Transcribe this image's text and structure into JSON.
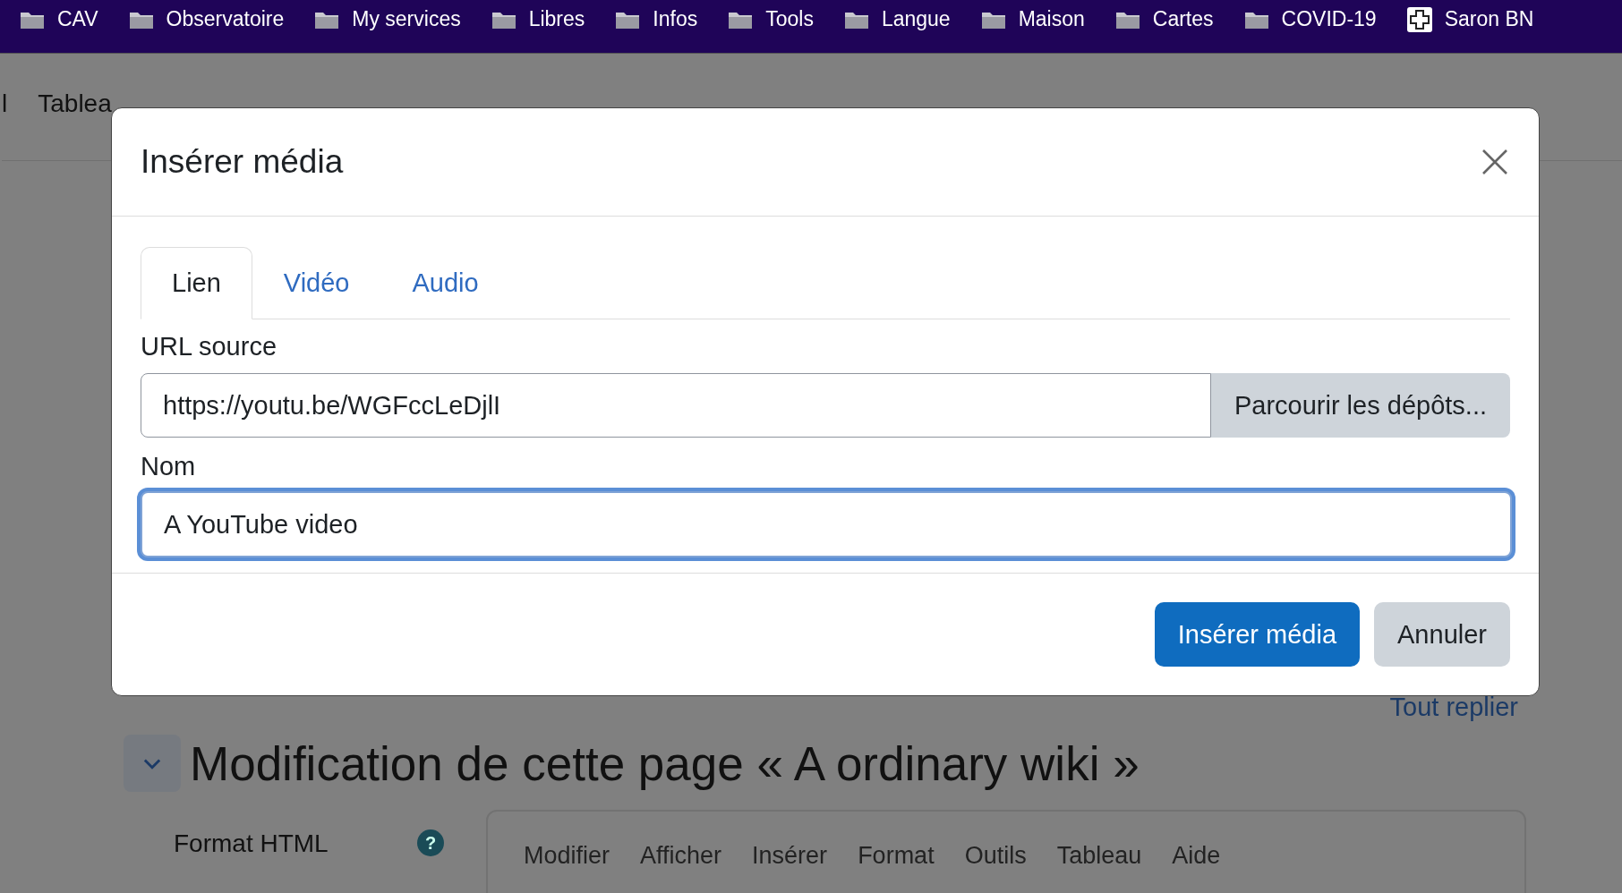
{
  "bookmarks": [
    {
      "label": "CAV",
      "kind": "folder"
    },
    {
      "label": "Observatoire",
      "kind": "folder"
    },
    {
      "label": "My services",
      "kind": "folder"
    },
    {
      "label": "Libres",
      "kind": "folder"
    },
    {
      "label": "Infos",
      "kind": "folder"
    },
    {
      "label": "Tools",
      "kind": "folder"
    },
    {
      "label": "Langue",
      "kind": "folder"
    },
    {
      "label": "Maison",
      "kind": "folder"
    },
    {
      "label": "Cartes",
      "kind": "folder"
    },
    {
      "label": "COVID-19",
      "kind": "folder"
    },
    {
      "label": "Saron BN",
      "kind": "plus"
    }
  ],
  "nav": [
    "l",
    "Tablea"
  ],
  "dialog": {
    "title": "Insérer média",
    "tabs": [
      {
        "label": "Lien",
        "selected": true
      },
      {
        "label": "Vidéo",
        "selected": false
      },
      {
        "label": "Audio",
        "selected": false
      }
    ],
    "url_label": "URL source",
    "url_value": "https://youtu.be/WGFccLeDjlI",
    "browse_button": "Parcourir les dépôts...",
    "name_label": "Nom",
    "name_value": "A YouTube video",
    "buttons": [
      {
        "label": "Insérer média",
        "kind": "primary"
      },
      {
        "label": "Annuler",
        "kind": "secondary"
      }
    ]
  },
  "collapse_link": "Tout replier",
  "heading": "Modification de cette page « A ordinary wiki »",
  "format_label": "Format HTML",
  "help_icon": "?",
  "editor_menu": [
    "Modifier",
    "Afficher",
    "Insérer",
    "Format",
    "Outils",
    "Tableau",
    "Aide"
  ]
}
